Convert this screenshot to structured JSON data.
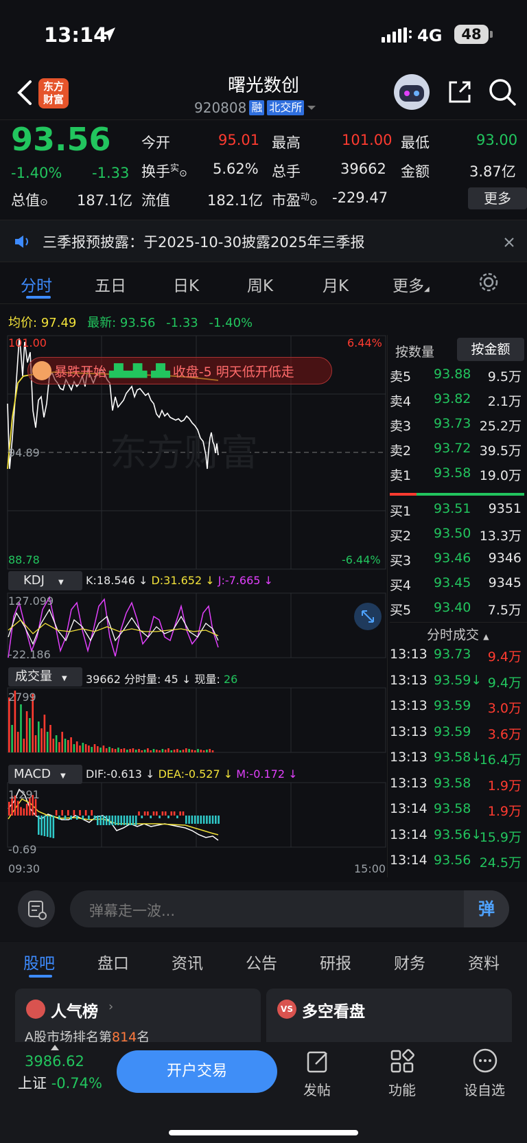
{
  "status": {
    "time": "13:14",
    "network": "4G",
    "battery": "48"
  },
  "header": {
    "logo_line1": "东方",
    "logo_line2": "财富",
    "title": "曙光数创",
    "code": "920808",
    "tag1": "融",
    "tag2": "北交所"
  },
  "quote": {
    "price": "93.56",
    "change_pct": "-1.40%",
    "change": "-1.33",
    "open_label": "今开",
    "open": "95.01",
    "high_label": "最高",
    "high": "101.00",
    "low_label": "最低",
    "low": "93.00",
    "turnover_label": "换手",
    "turnover_sup": "实",
    "turnover": "5.62%",
    "volume_label": "总手",
    "volume": "39662",
    "amount_label": "金额",
    "amount": "3.87亿",
    "mcap_label": "总值",
    "mcap": "187.1亿",
    "float_label": "流值",
    "float": "182.1亿",
    "pe_label": "市盈",
    "pe_sup": "动",
    "pe": "-229.47",
    "more": "更多"
  },
  "notice": {
    "text": "三季报预披露：于2025-10-30披露2025年三季报"
  },
  "tabs": [
    "分时",
    "五日",
    "日K",
    "周K",
    "月K",
    "更多"
  ],
  "infoline": {
    "avg_label": "均价:",
    "avg": "97.49",
    "latest_label": "最新:",
    "latest": "93.56",
    "chg": "-1.33",
    "pct": "-1.40%"
  },
  "chart": {
    "top_price": "101.00",
    "mid_price": "94.89",
    "bottom_price": "88.78",
    "top_pct": "6.44%",
    "bottom_pct": "-6.44%",
    "watermark": "东方财富",
    "banner": "暴跌开始",
    "banner2": "收盘-5 明天低开低走",
    "time_start": "09:30",
    "time_end": "15:00"
  },
  "kdj": {
    "label": "KDJ",
    "k": "K:18.546 ↓",
    "d": "D:31.652 ↓",
    "j": "J:-7.665 ↓",
    "max": "127.099",
    "min": "-22.186"
  },
  "vol": {
    "label": "成交量",
    "total": "39662",
    "min_label": "分时量:",
    "min_val": "45 ↓",
    "cur_label": "现量:",
    "cur_val": "26",
    "max": "2799"
  },
  "macd": {
    "label": "MACD",
    "dif": "DIF:-0.613 ↓",
    "dea": "DEA:-0.527 ↓",
    "m": "M:-0.172 ↓",
    "max": "1.291",
    "min": "-0.69"
  },
  "orderbook": {
    "tab1": "按数量",
    "tab2": "按金额",
    "sell": [
      {
        "l": "卖5",
        "p": "93.88",
        "v": "9.5万"
      },
      {
        "l": "卖4",
        "p": "93.82",
        "v": "2.1万"
      },
      {
        "l": "卖3",
        "p": "93.73",
        "v": "25.2万"
      },
      {
        "l": "卖2",
        "p": "93.72",
        "v": "39.5万"
      },
      {
        "l": "卖1",
        "p": "93.58",
        "v": "19.0万"
      }
    ],
    "buy": [
      {
        "l": "买1",
        "p": "93.51",
        "v": "9351"
      },
      {
        "l": "买2",
        "p": "93.50",
        "v": "13.3万"
      },
      {
        "l": "买3",
        "p": "93.46",
        "v": "9346"
      },
      {
        "l": "买4",
        "p": "93.45",
        "v": "9345"
      },
      {
        "l": "买5",
        "p": "93.40",
        "v": "7.5万"
      }
    ]
  },
  "ticks": {
    "title": "分时成交",
    "rows": [
      {
        "t": "13:13",
        "p": "93.73",
        "v": "9.4万",
        "c": "red"
      },
      {
        "t": "13:13",
        "p": "93.59↓",
        "v": "9.4万",
        "c": "green"
      },
      {
        "t": "13:13",
        "p": "93.59",
        "v": "3.0万",
        "c": "red"
      },
      {
        "t": "13:13",
        "p": "93.59",
        "v": "3.6万",
        "c": "red"
      },
      {
        "t": "13:13",
        "p": "93.58↓",
        "v": "16.4万",
        "c": "green"
      },
      {
        "t": "13:13",
        "p": "93.58",
        "v": "1.9万",
        "c": "red"
      },
      {
        "t": "13:14",
        "p": "93.58",
        "v": "1.9万",
        "c": "red"
      },
      {
        "t": "13:14",
        "p": "93.56↓",
        "v": "15.9万",
        "c": "green"
      },
      {
        "t": "13:14",
        "p": "93.56",
        "v": "24.5万",
        "c": "green"
      }
    ]
  },
  "danmu": {
    "placeholder": "弹幕走一波...",
    "btn": "弹"
  },
  "subtabs": [
    "股吧",
    "盘口",
    "资讯",
    "公告",
    "研报",
    "财务",
    "资料"
  ],
  "cards": {
    "c1_title": "人气榜",
    "c1_sub_a": "A股市场排名第",
    "c1_rank": "814",
    "c1_sub_b": "名",
    "c2_title": "多空看盘"
  },
  "bottom": {
    "index_val": "3986.62",
    "index_name": "上证",
    "index_pct": "-0.74%",
    "trade": "开户交易",
    "post": "发帖",
    "func": "功能",
    "watch": "设自选"
  }
}
